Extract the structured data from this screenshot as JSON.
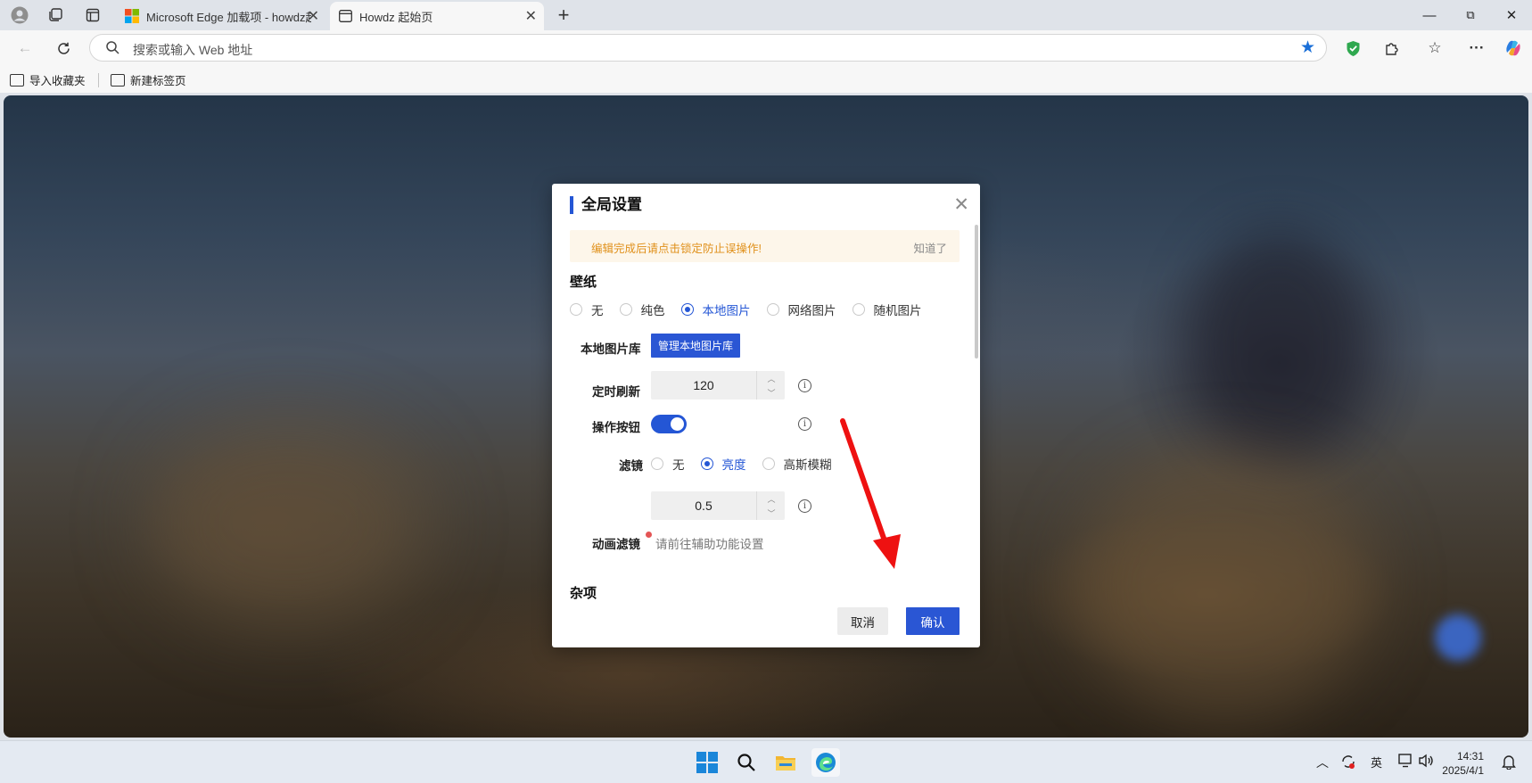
{
  "browser": {
    "tabs": [
      {
        "title": "Microsoft Edge 加载项 - howdz起",
        "active": false
      },
      {
        "title": "Howdz 起始页",
        "active": true
      }
    ],
    "new_tab_glyph": "+",
    "window_controls": {
      "minimize": "—",
      "maximize": "⧉",
      "close": "✕"
    },
    "address_placeholder": "搜索或输入 Web 地址",
    "favorites": [
      {
        "label": "导入收藏夹",
        "icon": "import-favorites-icon"
      },
      {
        "label": "新建标签页",
        "icon": "new-tab-page-icon"
      }
    ]
  },
  "modal": {
    "title": "全局设置",
    "notice_text": "编辑完成后请点击锁定防止误操作!",
    "notice_dismiss": "知道了",
    "wallpaper": {
      "heading": "壁纸",
      "options": [
        "无",
        "纯色",
        "本地图片",
        "网络图片",
        "随机图片"
      ],
      "selected": "本地图片",
      "library_label": "本地图片库",
      "library_button": "管理本地图片库",
      "refresh_label": "定时刷新",
      "refresh_value": "120",
      "action_buttons_label": "操作按钮",
      "action_buttons_on": true,
      "filter_label": "滤镜",
      "filter_options": [
        "无",
        "亮度",
        "高斯模糊"
      ],
      "filter_selected": "亮度",
      "filter_value": "0.5",
      "animation_filter_label": "动画滤镜",
      "animation_filter_hint": "请前往辅助功能设置"
    },
    "misc_heading": "杂项",
    "cancel_label": "取消",
    "confirm_label": "确认"
  },
  "taskbar": {
    "ime": "英",
    "time": "14:31",
    "date": "2025/4/1"
  },
  "colors": {
    "accent": "#2456d5",
    "notice_text": "#e0901a",
    "annotation_arrow": "#ee1111"
  }
}
